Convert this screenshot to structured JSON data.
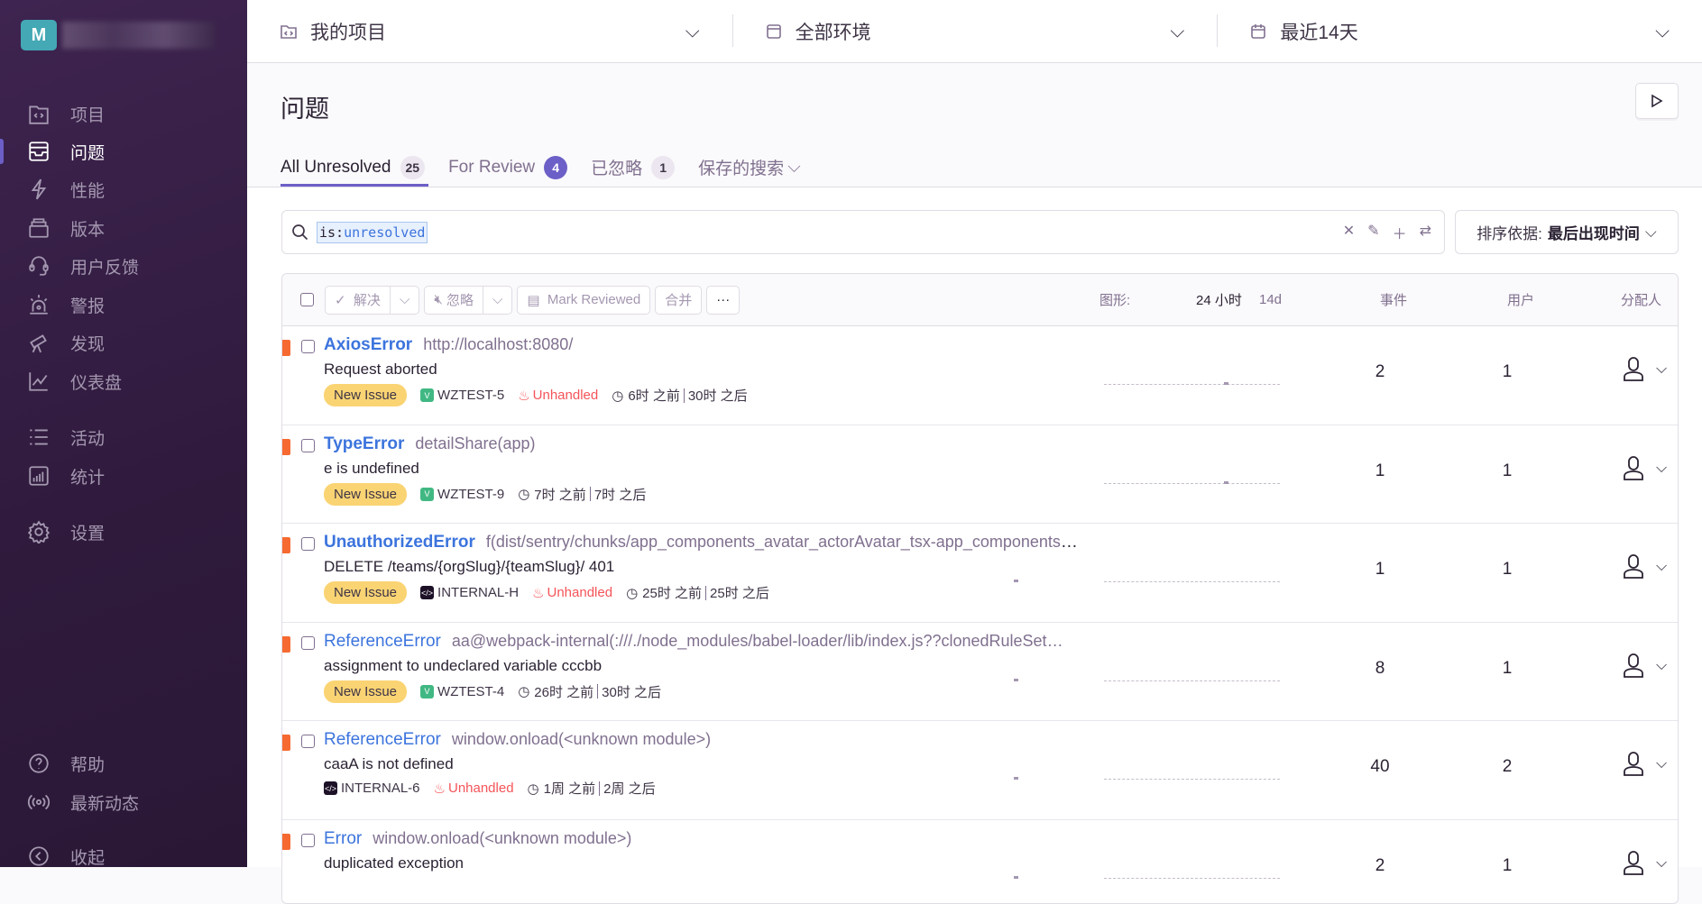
{
  "org": {
    "initial": "M"
  },
  "sidebar": {
    "items": [
      {
        "label": "项目",
        "icon": "project-folder-icon"
      },
      {
        "label": "问题",
        "icon": "issues-inbox-icon",
        "active": true
      },
      {
        "label": "性能",
        "icon": "lightning-icon"
      },
      {
        "label": "版本",
        "icon": "releases-icon"
      },
      {
        "label": "用户反馈",
        "icon": "headset-icon"
      },
      {
        "label": "警报",
        "icon": "siren-icon"
      },
      {
        "label": "发现",
        "icon": "telescope-icon"
      },
      {
        "label": "仪表盘",
        "icon": "chart-line-icon"
      },
      {
        "label": "活动",
        "icon": "list-icon"
      },
      {
        "label": "统计",
        "icon": "stats-icon"
      },
      {
        "label": "设置",
        "icon": "gear-icon"
      }
    ],
    "bottom": [
      {
        "label": "帮助",
        "icon": "help-icon"
      },
      {
        "label": "最新动态",
        "icon": "broadcast-icon"
      },
      {
        "label": "收起",
        "icon": "collapse-icon"
      }
    ]
  },
  "topbar": {
    "project": "我的项目",
    "environment": "全部环境",
    "period": "最近14天"
  },
  "page": {
    "title": "问题"
  },
  "tabs": [
    {
      "label": "All Unresolved",
      "count": "25",
      "active": true
    },
    {
      "label": "For Review",
      "count": "4",
      "purple": true
    },
    {
      "label": "已忽略",
      "count": "1"
    },
    {
      "label": "保存的搜索"
    }
  ],
  "search": {
    "key": "is:",
    "value": "unresolved"
  },
  "sort": {
    "label": "排序依据:",
    "value": "最后出现时间"
  },
  "toolbar": {
    "resolve": "解决",
    "ignore": "忽略",
    "mark_reviewed": "Mark Reviewed",
    "merge": "合并",
    "more": "···",
    "graph": "图形:",
    "period_24h": "24 小时",
    "period_14d": "14d",
    "events": "事件",
    "users": "用户",
    "assignee": "分配人"
  },
  "colors": {
    "accent": "#6c5fc7",
    "sidebar": "#2f1a3c",
    "link": "#3c74dd",
    "level_error": "#f66a32",
    "new_badge": "#fad473",
    "unhandled": "#f55459"
  },
  "issues": [
    {
      "type": "AxiosError",
      "bold": true,
      "location": "http://localhost:8080/",
      "message": "Request aborted",
      "new": true,
      "project": "WZTEST-5",
      "platform": "vue",
      "unhandled": true,
      "age": "6时 之前",
      "first": "30时 之后",
      "events": "2",
      "users": "1"
    },
    {
      "type": "TypeError",
      "bold": true,
      "location": "detailShare(app)",
      "message": "e is undefined",
      "new": true,
      "project": "WZTEST-9",
      "platform": "vue",
      "unhandled": false,
      "age": "7时 之前",
      "first": "7时 之后",
      "events": "1",
      "users": "1"
    },
    {
      "type": "UnauthorizedError",
      "bold": true,
      "location": "f(dist/sentry/chunks/app_components_avatar_actorAvatar_tsx-app_components_avatar_actorAvatar_tsx-app_com…",
      "message": "DELETE /teams/{orgSlug}/{teamSlug}/ 401",
      "new": true,
      "project": "INTERNAL-H",
      "platform": "js",
      "unhandled": true,
      "age": "25时 之前",
      "first": "25时 之后",
      "events": "1",
      "users": "1"
    },
    {
      "type": "ReferenceError",
      "bold": false,
      "location": "aa@webpack-internal(:///./node_modules/babel-loader/lib/index.js??clonedRuleSet…",
      "message": "assignment to undeclared variable cccbb",
      "new": true,
      "project": "WZTEST-4",
      "platform": "vue",
      "unhandled": false,
      "age": "26时 之前",
      "first": "30时 之后",
      "events": "8",
      "users": "1"
    },
    {
      "type": "ReferenceError",
      "bold": false,
      "location": "window.onload(<unknown module>)",
      "message": "caaA is not defined",
      "new": false,
      "project": "INTERNAL-6",
      "platform": "js",
      "unhandled": true,
      "age": "1周 之前",
      "first": "2周 之后",
      "events": "40",
      "users": "2"
    },
    {
      "type": "Error",
      "bold": false,
      "location": "window.onload(<unknown module>)",
      "message": "duplicated exception",
      "new": false,
      "project": "",
      "platform": "",
      "unhandled": false,
      "age": "",
      "first": "",
      "events": "2",
      "users": "1"
    }
  ],
  "labels": {
    "new_issue": "New Issue",
    "unhandled": "Unhandled"
  }
}
